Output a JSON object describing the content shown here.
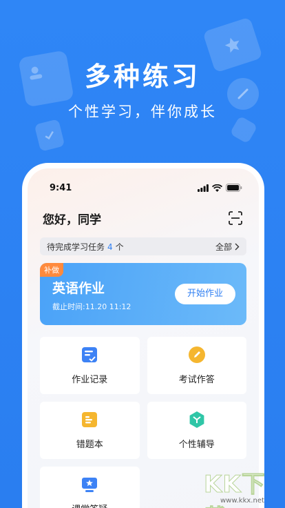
{
  "hero": {
    "title": "多种练习",
    "subtitle": "个性学习，伴你成长"
  },
  "status_bar": {
    "time": "9:41",
    "icons": [
      "signal-icon",
      "wifi-icon",
      "battery-icon"
    ]
  },
  "header": {
    "greeting": "您好，同学",
    "scan_icon": "scan-icon"
  },
  "task_bar": {
    "prefix": "待完成学习任务",
    "count": "4",
    "suffix": "个",
    "all_label": "全部"
  },
  "homework_card": {
    "tag": "补做",
    "title": "英语作业",
    "deadline": "截止时间:11.20 11:12",
    "button": "开始作业"
  },
  "tiles": [
    {
      "label": "作业记录",
      "icon": "homework-record-icon",
      "color": "#3d82f5"
    },
    {
      "label": "考试作答",
      "icon": "pencil-icon",
      "color": "#f5b62f"
    },
    {
      "label": "错题本",
      "icon": "notebook-icon",
      "color": "#f5b62f"
    },
    {
      "label": "个性辅导",
      "icon": "tutoring-icon",
      "color": "#2fc6a7"
    },
    {
      "label": "课堂答疑",
      "icon": "star-board-icon",
      "color": "#3d82f5"
    }
  ],
  "watermark": {
    "logo": "KK下载",
    "url": "www.kkx.net"
  },
  "colors": {
    "background": "#2f86f6",
    "accent": "#2f7ff2",
    "tag": "#ff8a3d"
  }
}
